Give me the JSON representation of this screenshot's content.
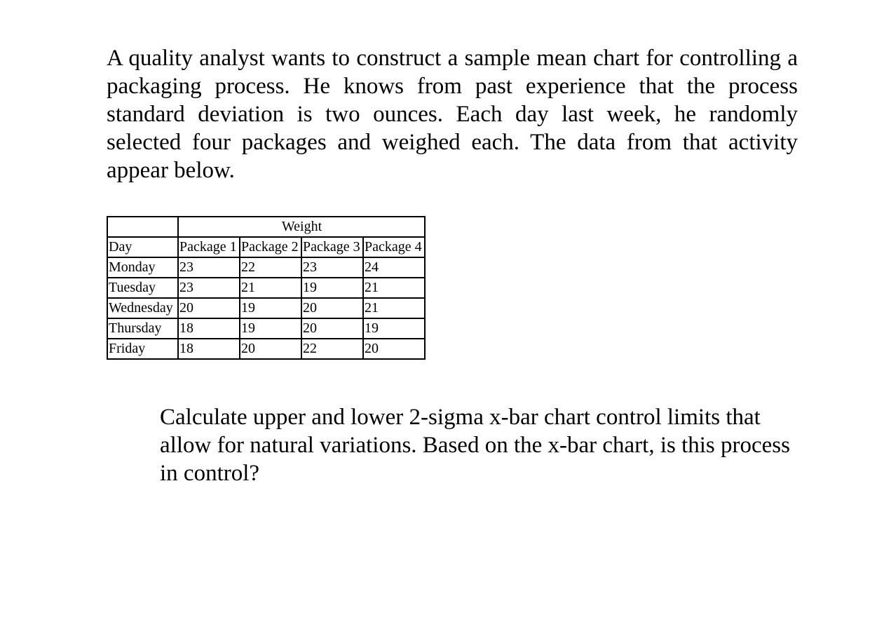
{
  "intro_text": "A quality analyst wants to construct a sample mean chart for controlling a packaging process. He knows from past experience that the process standard deviation is two ounces. Each day last week, he randomly selected four packages and weighed each. The data from that activity appear below.",
  "table": {
    "group_header": "Weight",
    "columns": [
      "Day",
      "Package 1",
      "Package 2",
      "Package 3",
      "Package 4"
    ],
    "rows": [
      [
        "Monday",
        "23",
        "22",
        "23",
        "24"
      ],
      [
        "Tuesday",
        "23",
        "21",
        "19",
        "21"
      ],
      [
        "Wednesday",
        "20",
        "19",
        "20",
        "21"
      ],
      [
        "Thursday",
        "18",
        "19",
        "20",
        "19"
      ],
      [
        "Friday",
        "18",
        "20",
        "22",
        "20"
      ]
    ]
  },
  "question_text": "Calculate upper and lower 2-sigma x-bar chart control limits that allow for natural variations. Based on the x-bar chart, is this process in control?"
}
